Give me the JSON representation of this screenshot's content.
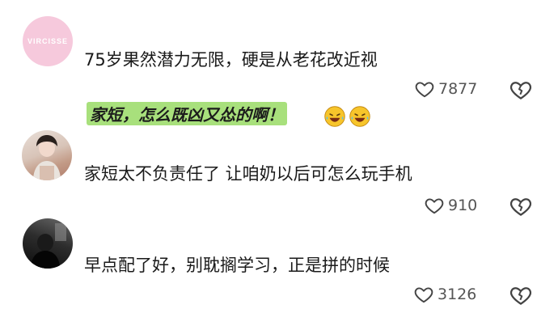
{
  "comments": [
    {
      "avatar_label": "VIRCISSE",
      "text": "75岁果然潜力无限，硬是从老花改近视",
      "likes": "7877",
      "avatar_icon": "pink-brand-avatar"
    },
    {
      "text": "家短太不负责任了 让咱奶以后可怎么玩手机",
      "likes": "910",
      "avatar_icon": "photo-avatar"
    },
    {
      "text": "早点配了好，别耽搁学习，正是拼的时候",
      "likes": "3126",
      "avatar_icon": "dark-photo-avatar"
    }
  ],
  "overlay": {
    "caption": "家短，怎么既凶又怂的啊！",
    "emoji": "rolling-on-floor-laughing-icon",
    "accent": "#a8e07c"
  },
  "icons": {
    "like": "heart-icon",
    "dislike": "broken-heart-icon"
  }
}
